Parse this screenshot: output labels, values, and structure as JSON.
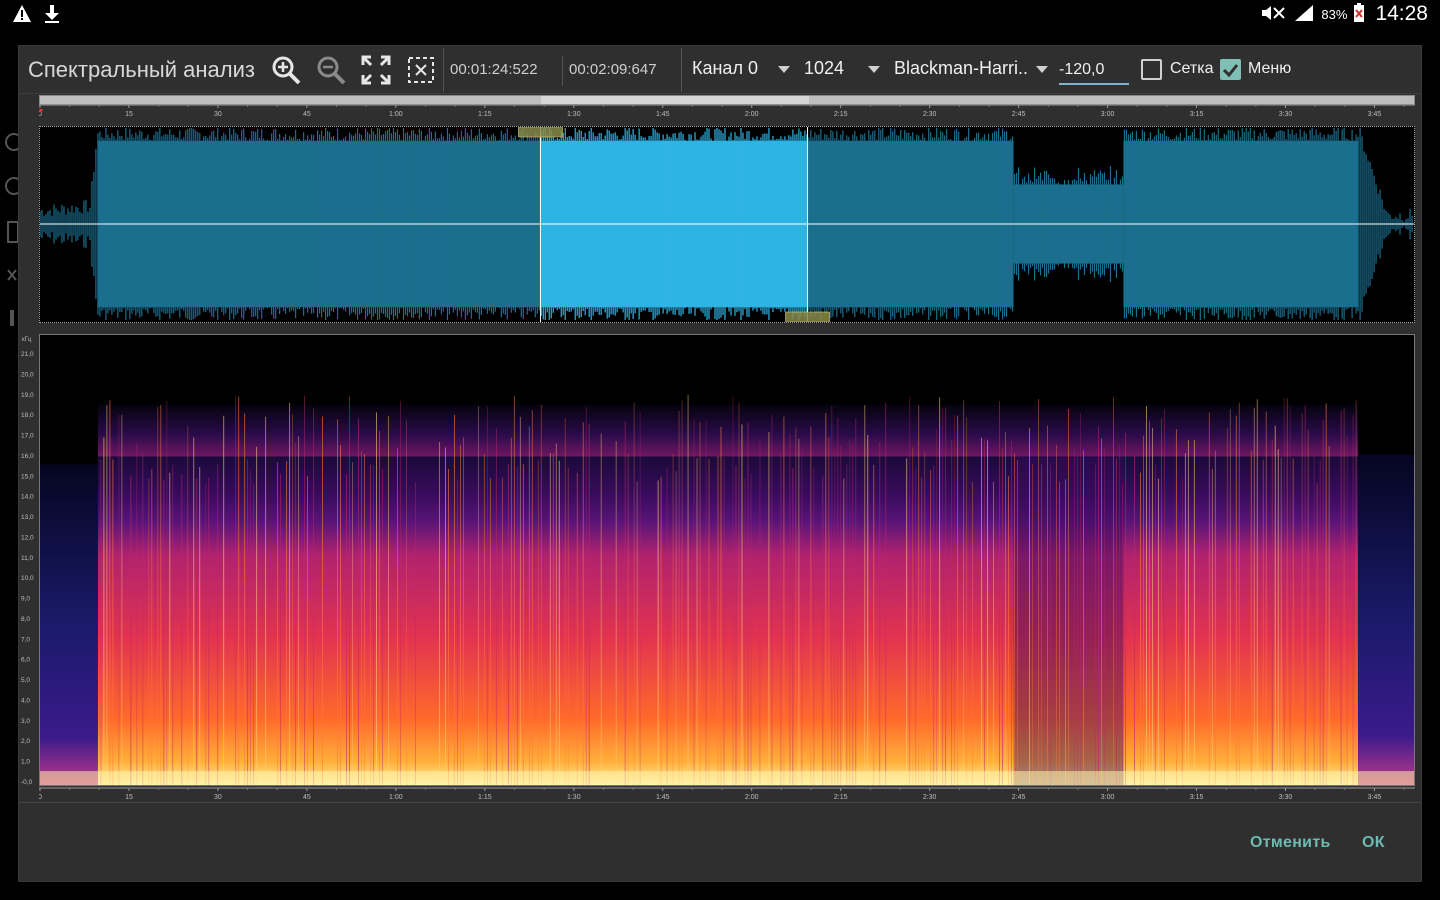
{
  "status_bar": {
    "left_icons": [
      "warning-icon",
      "download-icon"
    ],
    "right_icons": [
      "mute-icon",
      "signal-icon",
      "battery-icon"
    ],
    "battery": "83%",
    "clock": "14:28"
  },
  "toolbar": {
    "title": "Спектральный анализ",
    "icons": [
      "zoom-in-icon",
      "zoom-out-icon",
      "expand-icon",
      "select-all-icon"
    ],
    "time_start": "00:01:24:522",
    "time_end": "00:02:09:647",
    "channel": "Канал 0",
    "fft_size": "1024",
    "window": "Blackman-Harri..",
    "db_floor": "-120,0",
    "grid_label": "Сетка",
    "grid_checked": false,
    "menu_label": "Меню",
    "menu_checked": true
  },
  "timeline": {
    "ticks": [
      "0",
      "15",
      "30",
      "45",
      "1:00",
      "1:15",
      "1:30",
      "1:45",
      "2:00",
      "2:15",
      "2:30",
      "2:45",
      "3:00",
      "3:15",
      "3:30",
      "3:45"
    ],
    "duration_seconds": 232,
    "selection_start_seconds": 84.5,
    "selection_end_seconds": 129.6
  },
  "spectrogram": {
    "unit": "кГц",
    "freq_ticks": [
      "21,0",
      "20,0",
      "19,0",
      "18,0",
      "17,0",
      "16,0",
      "15,0",
      "14,0",
      "13,0",
      "12,0",
      "11,0",
      "10,0",
      "9,0",
      "8,0",
      "7,0",
      "6,0",
      "5,0",
      "4,0",
      "3,0",
      "2,0",
      "1,0",
      "-0,0"
    ]
  },
  "colors": {
    "waveform": "#1b6e8e",
    "waveform_selected": "#2fb4e4",
    "accent": "#6fb9b0"
  },
  "footer": {
    "cancel": "Отменить",
    "ok": "ОК"
  }
}
